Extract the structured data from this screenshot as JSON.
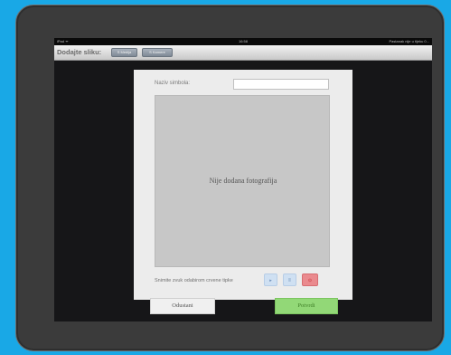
{
  "statusbar": {
    "carrier": "iPad ᯤ",
    "time": "16:58",
    "battery": "Pastanak nije u tijeku 0..."
  },
  "toolbar": {
    "title": "Dodajte sliku:",
    "buttons": [
      {
        "label": "S Medija"
      },
      {
        "label": "S Kamere"
      }
    ]
  },
  "dialog": {
    "name_label": "Naziv simbola:",
    "name_value": "",
    "photo_placeholder": "Nije dodana fotografija",
    "record_label": "Snimite zvuk odabirom crvene tipke",
    "record_buttons": {
      "play": "▸",
      "pause": "ll",
      "record": "⊙"
    }
  },
  "actions": {
    "cancel": "Odustani",
    "confirm": "Potvrdi"
  },
  "colors": {
    "background": "#19a8e6",
    "confirm": "#92d877",
    "record": "#ea8a8e"
  }
}
